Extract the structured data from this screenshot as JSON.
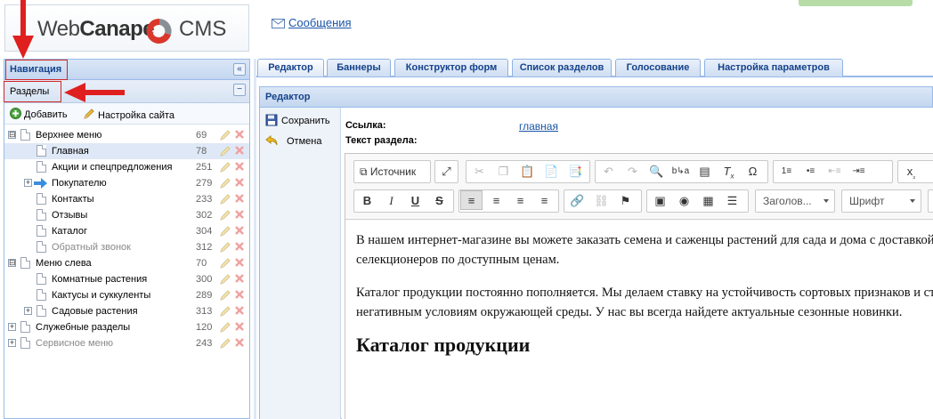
{
  "header": {
    "logo_web": "Web",
    "logo_canape": "Canape",
    "logo_cms": "CMS",
    "messages_link": "Сообщения"
  },
  "left_panel": {
    "title": "Навигация",
    "collapse_glyph": "«",
    "section_title": "Разделы",
    "section_collapse_glyph": "−",
    "toolbar": {
      "add_label": "Добавить",
      "settings_label": "Настройка сайта"
    },
    "tree": [
      {
        "label": "Верхнее меню",
        "num": "69",
        "level": 0,
        "expander": "⊟",
        "dim": false
      },
      {
        "label": "Главная",
        "num": "78",
        "level": 1,
        "expander": "",
        "selected": true,
        "dim": false
      },
      {
        "label": "Акции и спецпредложения",
        "num": "251",
        "level": 1,
        "expander": "",
        "dim": false
      },
      {
        "label": "Покупателю",
        "num": "279",
        "level": 1,
        "expander": "+",
        "arrow": true,
        "dim": false
      },
      {
        "label": "Контакты",
        "num": "233",
        "level": 1,
        "expander": "",
        "dim": false
      },
      {
        "label": "Отзывы",
        "num": "302",
        "level": 1,
        "expander": "",
        "dim": false
      },
      {
        "label": "Каталог",
        "num": "304",
        "level": 1,
        "expander": "",
        "dim": false
      },
      {
        "label": "Обратный звонок",
        "num": "312",
        "level": 1,
        "expander": "",
        "dim": true
      },
      {
        "label": "Меню слева",
        "num": "70",
        "level": 0,
        "expander": "⊟",
        "dim": false
      },
      {
        "label": "Комнатные растения",
        "num": "300",
        "level": 1,
        "expander": "",
        "dim": false
      },
      {
        "label": "Кактусы и суккуленты",
        "num": "289",
        "level": 1,
        "expander": "",
        "dim": false
      },
      {
        "label": "Садовые растения",
        "num": "313",
        "level": 1,
        "expander": "+",
        "dim": false
      },
      {
        "label": "Служебные разделы",
        "num": "120",
        "level": 0,
        "expander": "+",
        "dim": false
      },
      {
        "label": "Сервисное меню",
        "num": "243",
        "level": 0,
        "expander": "+",
        "dim": true
      }
    ]
  },
  "tabs": [
    "Редактор",
    "Баннеры",
    "Конструктор форм",
    "Список разделов",
    "Голосование",
    "Настройка параметров"
  ],
  "editor": {
    "panel_title": "Редактор",
    "save_label": "Сохранить",
    "cancel_label": "Отмена",
    "link_label": "Ссылка:",
    "link_value": "главная",
    "text_label": "Текст раздела:",
    "toolbar": {
      "source_label": "Источник",
      "format_combo": "Заголов...",
      "font_combo": "Шрифт"
    },
    "content": {
      "p1_line1": "В нашем интернет-магазине вы можете заказать семена и саженцы растений для сада и дома с доставкой от ведущих",
      "p1_line2": "селекционеров по доступным ценам.",
      "p2_line1": "Каталог продукции постоянно пополняется. Мы делаем ставку на устойчивость сортовых признаков и стойкость к",
      "p2_line2": "негативным условиям окружающей среды. У нас вы всегда найдете актуальные сезонные новинки.",
      "heading": "Каталог продукции"
    }
  },
  "colors": {
    "accent_blue": "#15428b",
    "panel_border": "#99bbe8",
    "annotation_red": "#e0201f",
    "link_blue": "#1a55a8"
  }
}
